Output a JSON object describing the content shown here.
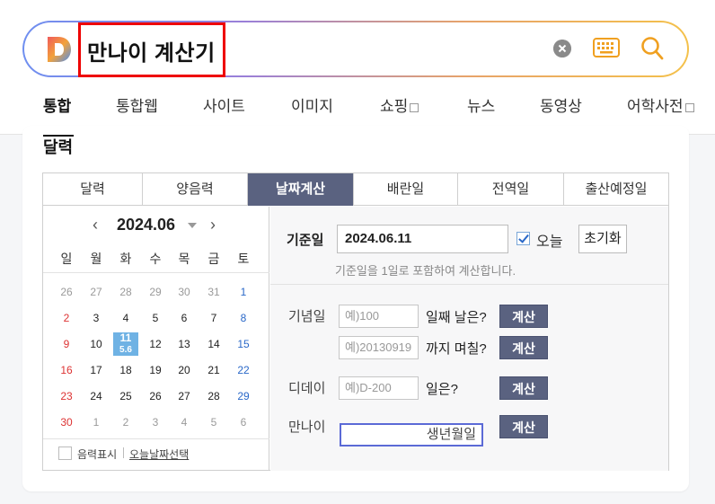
{
  "search": {
    "query": "만나이 계산기"
  },
  "tabs": [
    {
      "label": "통합",
      "active": true
    },
    {
      "label": "통합웹"
    },
    {
      "label": "사이트"
    },
    {
      "label": "이미지"
    },
    {
      "label": "쇼핑"
    },
    {
      "label": "뉴스"
    },
    {
      "label": "동영상"
    },
    {
      "label": "어학사전"
    }
  ],
  "card": {
    "title": "달력"
  },
  "widget_tabs": [
    {
      "label": "달력"
    },
    {
      "label": "양음력"
    },
    {
      "label": "날짜계산",
      "active": true
    },
    {
      "label": "배란일"
    },
    {
      "label": "전역일"
    },
    {
      "label": "출산예정일"
    }
  ],
  "calendar": {
    "month": "2024.06",
    "prev": "‹",
    "next": "›",
    "weekdays": [
      "일",
      "월",
      "화",
      "수",
      "목",
      "금",
      "토"
    ],
    "weeks": [
      [
        "26",
        "27",
        "28",
        "29",
        "30",
        "31",
        "1"
      ],
      [
        "2",
        "3",
        "4",
        "5",
        "6",
        "7",
        "8"
      ],
      [
        "9",
        "10",
        "11",
        "12",
        "13",
        "14",
        "15"
      ],
      [
        "16",
        "17",
        "18",
        "19",
        "20",
        "21",
        "22"
      ],
      [
        "23",
        "24",
        "25",
        "26",
        "27",
        "28",
        "29"
      ],
      [
        "30",
        "1",
        "2",
        "3",
        "4",
        "5",
        "6"
      ]
    ],
    "today_lunar": "5.6",
    "lunar_toggle": "음력표시",
    "today_link": "오늘날짜선택"
  },
  "calc": {
    "base_label": "기준일",
    "base_value": "2024.06.11",
    "today_label": "오늘",
    "today_checked": true,
    "reset_label": "초기화",
    "hint": "기준일을 1일로 포함하여 계산합니다.",
    "anniversary_label": "기념일",
    "anniversary_placeholder": "예)100",
    "anniversary_suffix": "일째 날은?",
    "until_placeholder": "예)20130919",
    "until_suffix": "까지 며칠?",
    "dday_label": "디데이",
    "dday_placeholder": "예)D-200",
    "dday_suffix": "일은?",
    "age_label": "만나이",
    "age_placeholder": "생년월일",
    "calc_button": "계산"
  },
  "colors": {
    "accent": "#5a6280",
    "today": "#6fb2e4",
    "sunday": "#dd3333",
    "saturday": "#2a68c8"
  }
}
